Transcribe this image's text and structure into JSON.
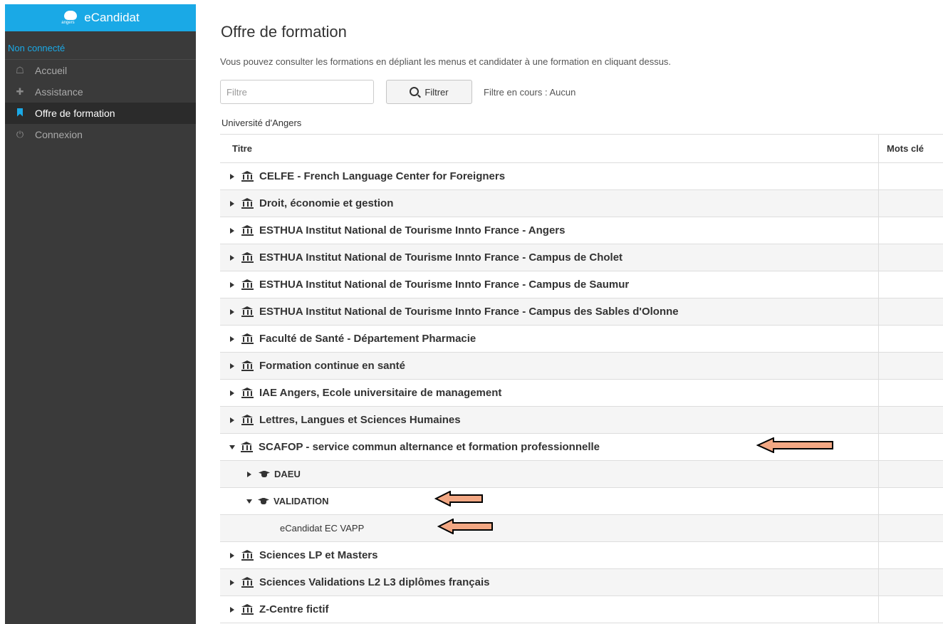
{
  "sidebar": {
    "brand": "eCandidat",
    "brand_logo_text": "angers",
    "user_status": "Non connecté",
    "items": [
      {
        "label": "Accueil",
        "icon": "home-icon",
        "active": false
      },
      {
        "label": "Assistance",
        "icon": "ambulance-icon",
        "active": false
      },
      {
        "label": "Offre de formation",
        "icon": "bookmark-icon",
        "active": true
      },
      {
        "label": "Connexion",
        "icon": "power-icon",
        "active": false
      }
    ]
  },
  "main": {
    "title": "Offre de formation",
    "intro": "Vous pouvez consulter les formations en dépliant les menus et candidater à une formation en cliquant dessus.",
    "filter": {
      "placeholder": "Filtre",
      "button": "Filtrer",
      "status": "Filtre en cours : Aucun"
    },
    "university": "Université d'Angers",
    "table": {
      "headers": [
        "Titre",
        "Mots clé"
      ],
      "rows": [
        {
          "label": "CELFE - French Language Center for Foreigners",
          "level": 0,
          "expanded": false
        },
        {
          "label": "Droit, économie et gestion",
          "level": 0,
          "expanded": false
        },
        {
          "label": "ESTHUA Institut National de Tourisme Innto France - Angers",
          "level": 0,
          "expanded": false
        },
        {
          "label": "ESTHUA Institut National de Tourisme Innto France - Campus de Cholet",
          "level": 0,
          "expanded": false
        },
        {
          "label": "ESTHUA Institut National de Tourisme Innto France - Campus de Saumur",
          "level": 0,
          "expanded": false
        },
        {
          "label": "ESTHUA Institut National de Tourisme Innto France - Campus des Sables d'Olonne",
          "level": 0,
          "expanded": false
        },
        {
          "label": "Faculté de Santé - Département Pharmacie",
          "level": 0,
          "expanded": false
        },
        {
          "label": "Formation continue en santé",
          "level": 0,
          "expanded": false
        },
        {
          "label": "IAE Angers, Ecole universitaire de management",
          "level": 0,
          "expanded": false
        },
        {
          "label": "Lettres, Langues et Sciences Humaines",
          "level": 0,
          "expanded": false
        },
        {
          "label": "SCAFOP - service commun alternance et formation professionnelle",
          "level": 0,
          "expanded": true
        },
        {
          "label": "DAEU",
          "level": 1,
          "expanded": false
        },
        {
          "label": "VALIDATION",
          "level": 1,
          "expanded": true
        },
        {
          "label": "eCandidat EC VAPP",
          "level": 2
        },
        {
          "label": "Sciences LP et Masters",
          "level": 0,
          "expanded": false
        },
        {
          "label": "Sciences Validations L2 L3 diplômes français",
          "level": 0,
          "expanded": false
        },
        {
          "label": "Z-Centre fictif",
          "level": 0,
          "expanded": false
        }
      ]
    }
  },
  "colors": {
    "sidebar_bg": "#3a3a3a",
    "brand_bg": "#1aa9e6",
    "accent": "#1aa9e6",
    "arrow_fill": "#f2a783"
  }
}
